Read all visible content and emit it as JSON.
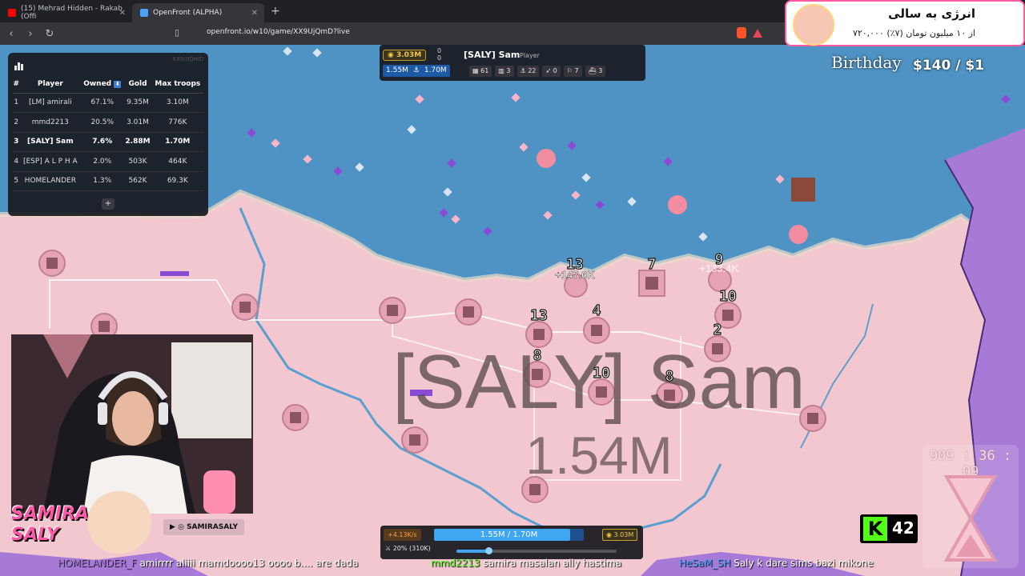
{
  "browser": {
    "tabs": [
      {
        "title": "(15) Mehrad Hidden - Rakab (Offi",
        "active": false
      },
      {
        "title": "OpenFront (ALPHA)",
        "active": true
      }
    ],
    "new_tab": "+",
    "url": "openfront.io/w10/game/XX9UjQmD?live"
  },
  "leaderboard": {
    "game_id": "XX9UjQmD",
    "headers": [
      "#",
      "Player",
      "Owned",
      "Gold",
      "Max troops"
    ],
    "rows": [
      {
        "rank": "1",
        "player": "[LM] amirali",
        "owned": "67.1%",
        "gold": "9.35M",
        "troops": "3.10M"
      },
      {
        "rank": "2",
        "player": "mmd2213",
        "owned": "20.5%",
        "gold": "3.01M",
        "troops": "776K"
      },
      {
        "rank": "3",
        "player": "[SALY] Sam",
        "owned": "7.6%",
        "gold": "2.88M",
        "troops": "1.70M"
      },
      {
        "rank": "4",
        "player": "[ESP] A L P H A",
        "owned": "2.0%",
        "gold": "503K",
        "troops": "464K"
      },
      {
        "rank": "5",
        "player": "HOMELANDER",
        "owned": "1.3%",
        "gold": "562K",
        "troops": "69.3K"
      }
    ],
    "expand": "+"
  },
  "player_info": {
    "gold": "3.03M",
    "counter_top": "0",
    "counter_bottom": "0",
    "name": "[SALY] Sam",
    "type": "Player",
    "troops": "1.55M",
    "max_troops": "1.70M",
    "stats": [
      "61",
      "3",
      "22",
      "0",
      "7",
      "3"
    ]
  },
  "map": {
    "territory_label": "[SALY] Sam",
    "territory_value": "1.54M",
    "gain1": "+147.6K",
    "gain2": "+133.4K",
    "unit_levels": [
      "13",
      "7",
      "9",
      "13",
      "4",
      "10",
      "2",
      "8",
      "10",
      "8"
    ]
  },
  "overlays": {
    "banner_title": "انرژی به سالی",
    "banner_sub": "۷۲۰,۰۰۰ از ۱۰ میلیون تومان (۷٪)",
    "birthday": "Birthday",
    "donation": "$140 / $1",
    "streamer_name_1": "SAMIRA",
    "streamer_name_2": "SALY",
    "social_handle": "SAMIRASALY"
  },
  "hud": {
    "rate": "+4.13K/s",
    "troops_label": "1.55M / 1.70M",
    "troop_fraction": 0.91,
    "gold": "3.03M",
    "attack_ratio": "20% (310K)",
    "attack_fraction": 0.2
  },
  "chat": [
    {
      "user": "HOMELANDER_F",
      "msg": "amirrrr aliiii mamdoooo13 oooo b.... are dada"
    },
    {
      "user": "mmd2213",
      "msg": "samira masalan ally hastima"
    },
    {
      "user": "HeSaM_SH",
      "msg": "Saly k dare sims bazi mikone"
    }
  ],
  "kick": {
    "followers": "42"
  },
  "timer": {
    "time": "909 : 36 : 09"
  },
  "colors": {
    "land": "#f2c7cf",
    "ocean": "#4f93c4",
    "river": "#5a9fd0",
    "purple_enemy": "#a77ad8",
    "gold": "#f3c84a",
    "troop_blue": "#3fa6f0"
  }
}
